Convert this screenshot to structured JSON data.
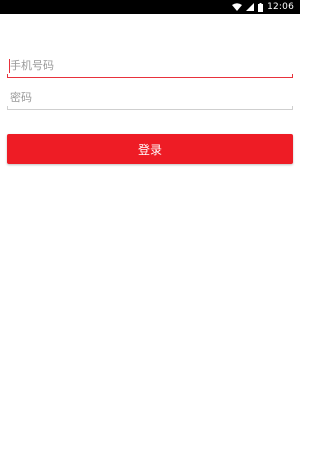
{
  "status_bar": {
    "time": "12:06",
    "icons": [
      "wifi-icon",
      "signal-icon",
      "battery-icon"
    ]
  },
  "form": {
    "phone_placeholder": "手机号码",
    "phone_value": "",
    "password_placeholder": "密码",
    "password_value": "",
    "login_label": "登录"
  },
  "colors": {
    "accent": "#ee1c25",
    "status_bar": "#000000",
    "background": "#ffffff"
  }
}
